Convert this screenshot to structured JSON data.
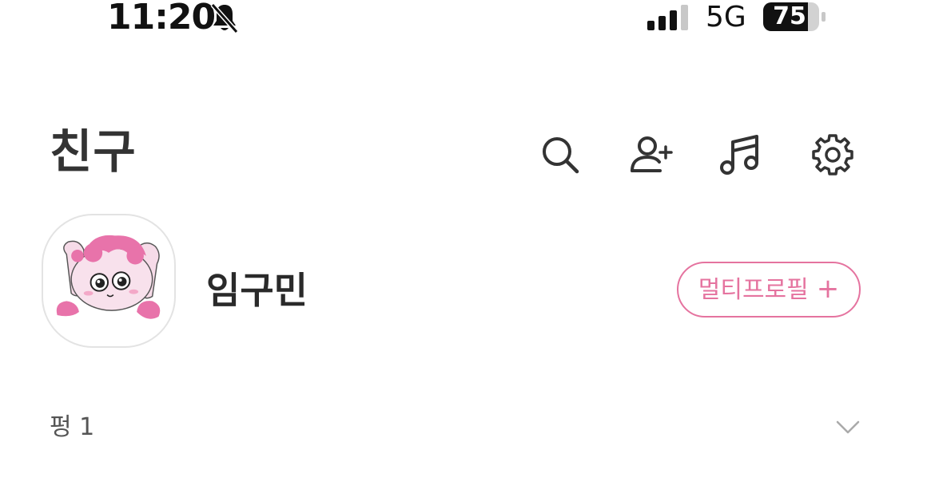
{
  "status_bar": {
    "time": "11:20",
    "network": "5G",
    "battery": "75"
  },
  "header": {
    "title": "친구",
    "icons": [
      "search-icon",
      "add-friend-icon",
      "music-icon",
      "settings-icon"
    ]
  },
  "profile": {
    "name": "임구민",
    "multi_profile_label": "멀티프로필",
    "multi_profile_plus": "+"
  },
  "group": {
    "label": "펑 1"
  },
  "colors": {
    "accent": "#e5739f",
    "text_dark": "#333333",
    "text_muted": "#555555"
  }
}
